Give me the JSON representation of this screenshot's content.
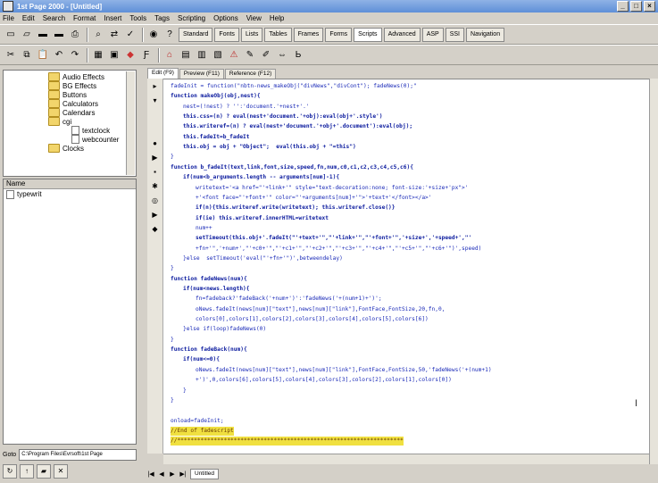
{
  "window": {
    "title": "1st Page 2000 - [Untitled]",
    "controls": [
      "_",
      "□",
      "×"
    ]
  },
  "menu": [
    "File",
    "Edit",
    "Search",
    "Format",
    "Insert",
    "Tools",
    "Tags",
    "Scripting",
    "Options",
    "View",
    "Help"
  ],
  "toolbar_tabs": [
    "Standard",
    "Fonts",
    "Lists",
    "Tables",
    "Frames",
    "Forms",
    "Scripts",
    "Advanced",
    "ASP",
    "SSI",
    "Navigation"
  ],
  "active_toolbar_tab": "Scripts",
  "folders": [
    {
      "label": "Audio Effects",
      "type": "folder",
      "indent": 2
    },
    {
      "label": "BG Effects",
      "type": "folder",
      "indent": 2
    },
    {
      "label": "Buttons",
      "type": "folder",
      "indent": 2
    },
    {
      "label": "Calculators",
      "type": "folder",
      "indent": 2
    },
    {
      "label": "Calendars",
      "type": "folder",
      "indent": 2
    },
    {
      "label": "cgi",
      "type": "folder",
      "indent": 2
    },
    {
      "label": "textclock",
      "type": "page",
      "indent": 3
    },
    {
      "label": "webcounter",
      "type": "page",
      "indent": 3
    },
    {
      "label": "Clocks",
      "type": "folder",
      "indent": 2
    }
  ],
  "file_pane": {
    "header": "Name",
    "item": "typewrit"
  },
  "path_bar": {
    "label": "Goto",
    "value": "C:\\Program Files\\Evrsoft\\1st Page"
  },
  "editor_tabs": [
    "Edit (F9)",
    "Preview (F11)",
    "Reference (F12)"
  ],
  "code_lines": [
    {
      "text": "fadeInit = function(\"nbtn-news_makeObj(\"divNews\",\"divCont\"); fadeNews(0);\"",
      "indent": 1
    },
    {
      "text": "function makeObj(obj,nest){",
      "indent": 1
    },
    {
      "text": "nest=(!nest) ? '':'document.'+nest+'.'",
      "indent": 2
    },
    {
      "text": "this.css=(n) ? eval(nest+'document.'+obj):eval(obj+'.style')",
      "indent": 2
    },
    {
      "text": "this.writeref=(n) ? eval(nest+'document.'+obj+'.document'):eval(obj);",
      "indent": 2
    },
    {
      "text": "this.fadeIt=b_fadeIt",
      "indent": 2
    },
    {
      "text": "this.obj = obj + \"Object\";  eval(this.obj + \"=this\")",
      "indent": 2
    },
    {
      "text": "}",
      "indent": 1
    },
    {
      "text": "function b_fadeIt(text,link,font,size,speed,fn,num,c0,c1,c2,c3,c4,c5,c6){",
      "indent": 1
    },
    {
      "text": "if(num<b_arguments.length -- arguments[num]-1){",
      "indent": 2
    },
    {
      "text": "writetext='<a href=\"'+link+'\" style=\"text-decoration:none; font-size:'+size+'px\">'",
      "indent": 3
    },
    {
      "text": "+'<font face=\"'+font+'\" color=\"'+arguments[num]+'\">'+text+'</font></a>'",
      "indent": 3
    },
    {
      "text": "if(n){this.writeref.write(writetext); this.writeref.close()}",
      "indent": 3
    },
    {
      "text": "if(ie) this.writeref.innerHTML=writetext",
      "indent": 3
    },
    {
      "text": "num++",
      "indent": 3
    },
    {
      "text": "setTimeout(this.obj+'.fadeIt(\"'+text+'\",\"'+link+'\",\"'+font+'\",'+size+','+speed+',\"'",
      "indent": 3
    },
    {
      "text": "+fn+'\",'+num+',\"'+c0+'\",\"'+c1+'\",\"'+c2+'\",\"'+c3+'\",\"'+c4+'\",\"'+c5+'\",\"'+c6+'\")',speed)",
      "indent": 3
    },
    {
      "text": "}else  setTimeout('eval(\"'+fn+'\")',betweendelay)",
      "indent": 2
    },
    {
      "text": "}",
      "indent": 1
    },
    {
      "text": "function fadeNews(num){",
      "indent": 1
    },
    {
      "text": "if(num<news.length){",
      "indent": 2
    },
    {
      "text": "fn=fadeback?'fadeBack('+num+')':'fadeNews('+(num+1)+')';",
      "indent": 3
    },
    {
      "text": "oNews.fadeIt(news[num][\"text\"],news[num][\"link\"],FontFace,FontSize,20,fn,0,",
      "indent": 3
    },
    {
      "text": "colors[0],colors[1],colors[2],colors[3],colors[4],colors[5],colors[6])",
      "indent": 3
    },
    {
      "text": "}else if(loop)fadeNews(0)",
      "indent": 2
    },
    {
      "text": "}",
      "indent": 1
    },
    {
      "text": "function fadeBack(num){",
      "indent": 1
    },
    {
      "text": "if(num<=0){",
      "indent": 2
    },
    {
      "text": "oNews.fadeIt(news[num][\"text\"],news[num][\"link\"],FontFace,FontSize,50,'fadeNews('+(num+1)",
      "indent": 3
    },
    {
      "text": "+')',0,colors[6],colors[5],colors[4],colors[3],colors[2],colors[1],colors[0])",
      "indent": 3
    },
    {
      "text": "}",
      "indent": 2
    },
    {
      "text": "}",
      "indent": 1
    },
    {
      "text": "",
      "indent": 1
    },
    {
      "text": "onload=fadeInit;",
      "indent": 1
    },
    {
      "text": "//End of fadescript",
      "indent": 1,
      "highlight": true
    },
    {
      "text": "//********************************************************************",
      "indent": 1,
      "highlight": true
    }
  ],
  "status_tab": "Untitled",
  "nav_arrows": [
    "|◀",
    "◀",
    "▶",
    "▶|"
  ],
  "colors": {
    "titlebar": "#5e8fd8",
    "code": "#1a2ab8",
    "highlight": "#f0e040"
  }
}
